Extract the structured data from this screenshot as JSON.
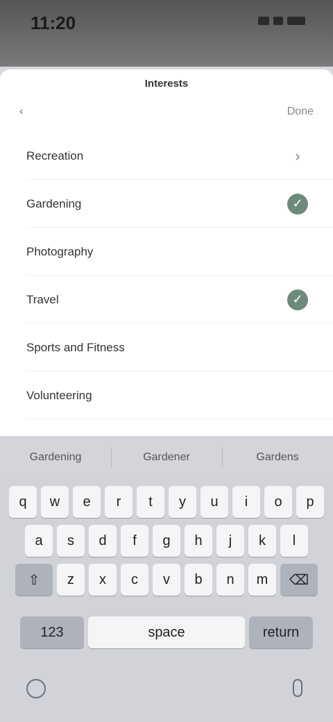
{
  "status_bar": {
    "time": "11:20"
  },
  "sheet": {
    "title": "Interests",
    "cancel_label": "‹",
    "done_label": "Done",
    "rows": [
      {
        "label": "Recreation",
        "state": "arrow"
      },
      {
        "label": "Gardening",
        "state": "on"
      },
      {
        "label": "Photography",
        "state": "off"
      },
      {
        "label": "Travel",
        "state": "on"
      },
      {
        "label": "Sports and Fitness",
        "state": "off"
      },
      {
        "label": "Volunteering",
        "state": "off"
      }
    ]
  },
  "keyboard": {
    "suggestions": [
      "Gardening",
      "Gardener",
      "Gardens"
    ],
    "row1": [
      "q",
      "w",
      "e",
      "r",
      "t",
      "y",
      "u",
      "i",
      "o",
      "p"
    ],
    "row2": [
      "a",
      "s",
      "d",
      "f",
      "g",
      "h",
      "j",
      "k",
      "l"
    ],
    "row3": [
      "z",
      "x",
      "c",
      "v",
      "b",
      "n",
      "m"
    ],
    "shift_label": "⇧",
    "delete_label": "⌫",
    "numbers_label": "123",
    "space_label": "space",
    "return_label": "return"
  },
  "colors": {
    "toggle_on": "#6f8a7c",
    "keyboard_bg": "#d1d3d9"
  }
}
